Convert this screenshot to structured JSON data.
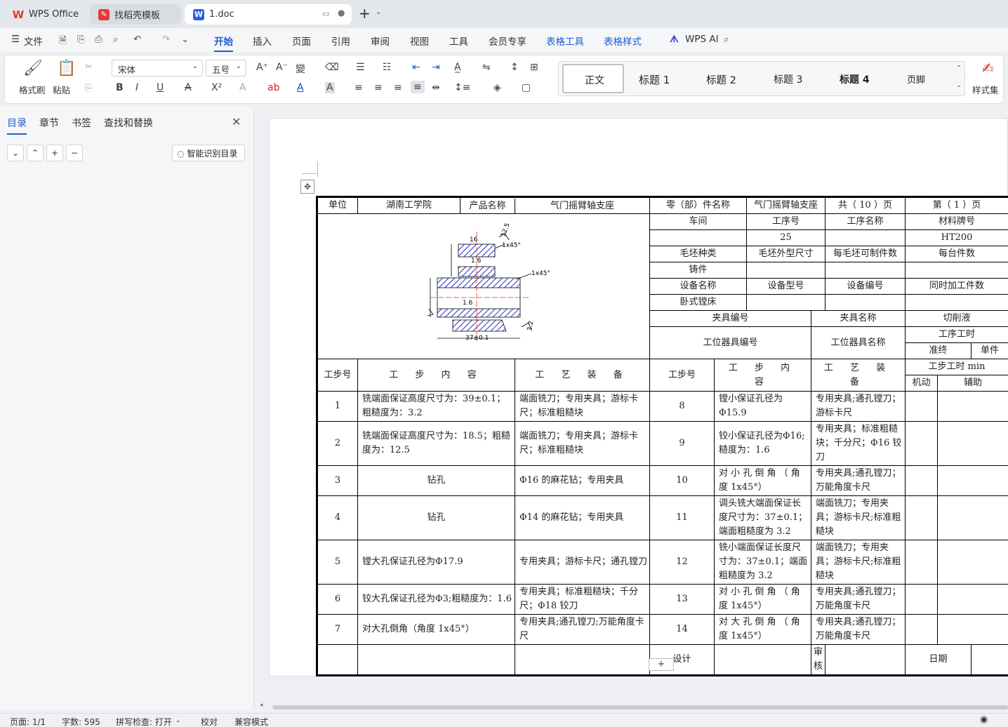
{
  "tabs": [
    {
      "label": "WPS Office",
      "icon": "wps-logo-icon"
    },
    {
      "label": "找稻壳模板",
      "icon": "docer-icon"
    },
    {
      "label": "1.doc",
      "icon": "word-doc-icon",
      "active": true
    }
  ],
  "menu": {
    "file": "文件",
    "items": [
      "开始",
      "插入",
      "页面",
      "引用",
      "审阅",
      "视图",
      "工具",
      "会员专享"
    ],
    "table_tools": "表格工具",
    "table_style": "表格样式",
    "ai": "WPS AI"
  },
  "ribbon": {
    "format_painter": "格式刷",
    "paste": "粘贴",
    "font": "宋体",
    "size": "五号",
    "styles": [
      "正文",
      "标题 1",
      "标题 2",
      "标题 3",
      "标题 4",
      "页脚"
    ],
    "style_set": "样式集"
  },
  "sidepanel": {
    "tabs": [
      "目录",
      "章节",
      "书签",
      "查找和替换"
    ],
    "smart_btn": "智能识别目录"
  },
  "card": {
    "unit_label": "单位",
    "unit": "湖南工学院",
    "product_label": "产品名称",
    "product": "气门摇臂轴支座",
    "part_label": "零（部）件名称",
    "part": "气门摇臂轴支座",
    "total_pages": "共（  10 ）页",
    "page_no": "第（ 1 ）页",
    "h1": [
      "车间",
      "工序号",
      "工序名称",
      "材料牌号"
    ],
    "v1": [
      "",
      "25",
      "",
      "HT200"
    ],
    "h2": [
      "毛坯种类",
      "毛坯外型尺寸",
      "每毛坯可制件数",
      "每台件数"
    ],
    "v2": [
      "铸件",
      "",
      "",
      ""
    ],
    "h3": [
      "设备名称",
      "设备型号",
      "设备编号",
      "同时加工件数"
    ],
    "v3": [
      "卧式镗床",
      "",
      "",
      ""
    ],
    "h4": [
      "夹具编号",
      "夹具名称",
      "切削液"
    ],
    "h5": [
      "工位器具编号",
      "工位器具名称",
      "工序工时"
    ],
    "prep": "准终",
    "unit_time": "单件",
    "step_col": "工步号",
    "content_col": "工 步 内 容",
    "equip_col": "工 艺 装 备",
    "time_col": "工步工时 min",
    "machine": "机动",
    "aux": "辅助",
    "drawing": {
      "d1": "16",
      "d2": "1.6",
      "d3": "1.6",
      "d4": "37±0.1",
      "r1": "12.5",
      "r2": "3.2",
      "c1": "1x45°"
    },
    "rows": [
      {
        "n1": "1",
        "c1": "铣端面保证高度尺寸为：39±0.1；粗糙度为：3.2",
        "e1": "端面铣刀；专用夹具；游标卡尺；标准粗糙块",
        "n2": "8",
        "c2": "镗小保证孔径为Φ15.9",
        "e2": "专用夹具;通孔镗刀；游标卡尺"
      },
      {
        "n1": "2",
        "c1": "铣端面保证高度尺寸为：18.5；粗糙度为：12.5",
        "e1": "端面铣刀；专用夹具；游标卡尺；标准粗糙块",
        "n2": "9",
        "c2": "铰小保证孔径为Φ16;糙度为：1.6",
        "e2": "专用夹具；标准粗糙块；千分尺；Φ16 铰刀"
      },
      {
        "n1": "3",
        "c1": "钻孔",
        "e1": "Φ16 的麻花钻；专用夹具",
        "n2": "10",
        "c2": "对 小 孔 倒 角 （ 角 度 1x45°）",
        "e2": "专用夹具;通孔镗刀；万能角度卡尺"
      },
      {
        "n1": "4",
        "c1": "钻孔",
        "e1": "Φ14 的麻花钻；专用夹具",
        "n2": "11",
        "c2": "调头铣大端面保证长度尺寸为：37±0.1；端面粗糙度为 3.2",
        "e2": "端面铣刀；专用夹具；游标卡尺;标准粗糙块"
      },
      {
        "n1": "5",
        "c1": "镗大孔保证孔径为Φ17.9",
        "e1": "专用夹具；游标卡尺；通孔镗刀",
        "n2": "12",
        "c2": "铣小端面保证长度尺寸为：37±0.1；端面粗糙度为 3.2",
        "e2": "端面铣刀；专用夹具；游标卡尺;标准粗糙块"
      },
      {
        "n1": "6",
        "c1": "铰大孔保证孔径为Φ3;粗糙度为：1.6",
        "e1": "专用夹具；标准粗糙块；千分尺；Φ18 铰刀",
        "n2": "13",
        "c2": "对 小 孔 倒 角 （ 角 度 1x45°）",
        "e2": "专用夹具;通孔镗刀；万能角度卡尺"
      },
      {
        "n1": "7",
        "c1": "对大孔倒角（角度 1x45°）",
        "e1": "专用夹具;通孔镗刀;万能角度卡尺",
        "n2": "14",
        "c2": "对 大 孔 倒 角 （ 角 度 1x45°）",
        "e2": "专用夹具;通孔镗刀；万能角度卡尺"
      }
    ],
    "design": "设计",
    "review": "审核",
    "date": "日期"
  },
  "status": {
    "page": "页面: 1/1",
    "words": "字数: 595",
    "spell": "拼写检查: 打开",
    "proof": "校对",
    "compat": "兼容模式"
  }
}
